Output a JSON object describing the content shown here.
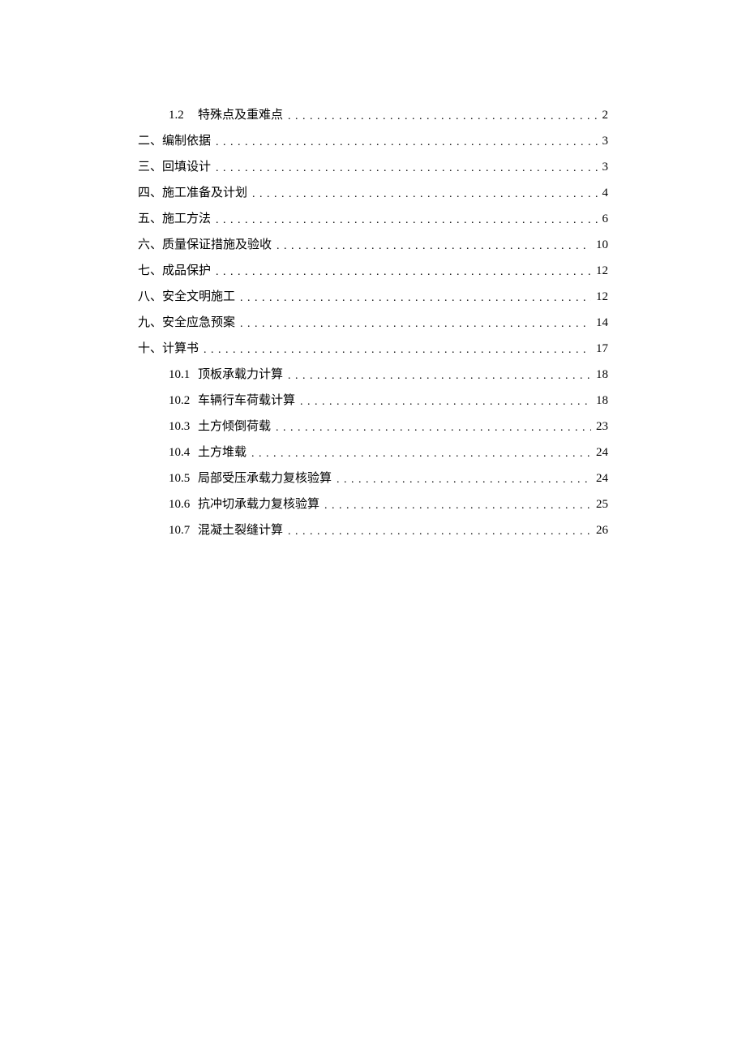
{
  "toc": [
    {
      "level": 2,
      "number": "1.2",
      "title": "特殊点及重难点",
      "page": "2"
    },
    {
      "level": 1,
      "prefix": "二、",
      "title": "编制依据",
      "page": "3"
    },
    {
      "level": 1,
      "prefix": "三、",
      "title": "回填设计",
      "page": "3"
    },
    {
      "level": 1,
      "prefix": "四、",
      "title": "施工准备及计划",
      "page": "4"
    },
    {
      "level": 1,
      "prefix": "五、",
      "title": "施工方法",
      "page": "6"
    },
    {
      "level": 1,
      "prefix": "六、",
      "title": "质量保证措施及验收",
      "page": "10"
    },
    {
      "level": 1,
      "prefix": "七、",
      "title": "成品保护",
      "page": "12"
    },
    {
      "level": 1,
      "prefix": "八、",
      "title": "安全文明施工",
      "page": "12"
    },
    {
      "level": 1,
      "prefix": "九、",
      "title": "安全应急预案",
      "page": "14"
    },
    {
      "level": 1,
      "prefix": "十、",
      "title": "计算书",
      "page": "17"
    },
    {
      "level": 2,
      "number": "10.1",
      "title": "顶板承载力计算",
      "page": "18"
    },
    {
      "level": 2,
      "number": "10.2",
      "title": "车辆行车荷载计算",
      "page": "18"
    },
    {
      "level": 2,
      "number": "10.3",
      "title": "土方倾倒荷载",
      "page": "23"
    },
    {
      "level": 2,
      "number": "10.4",
      "title": "土方堆载",
      "page": "24"
    },
    {
      "level": 2,
      "number": "10.5",
      "title": "局部受压承载力复核验算",
      "page": "24"
    },
    {
      "level": 2,
      "number": "10.6",
      "title": "抗冲切承载力复核验算",
      "page": "25"
    },
    {
      "level": 2,
      "number": "10.7",
      "title": "混凝土裂缝计算",
      "page": "26"
    }
  ]
}
